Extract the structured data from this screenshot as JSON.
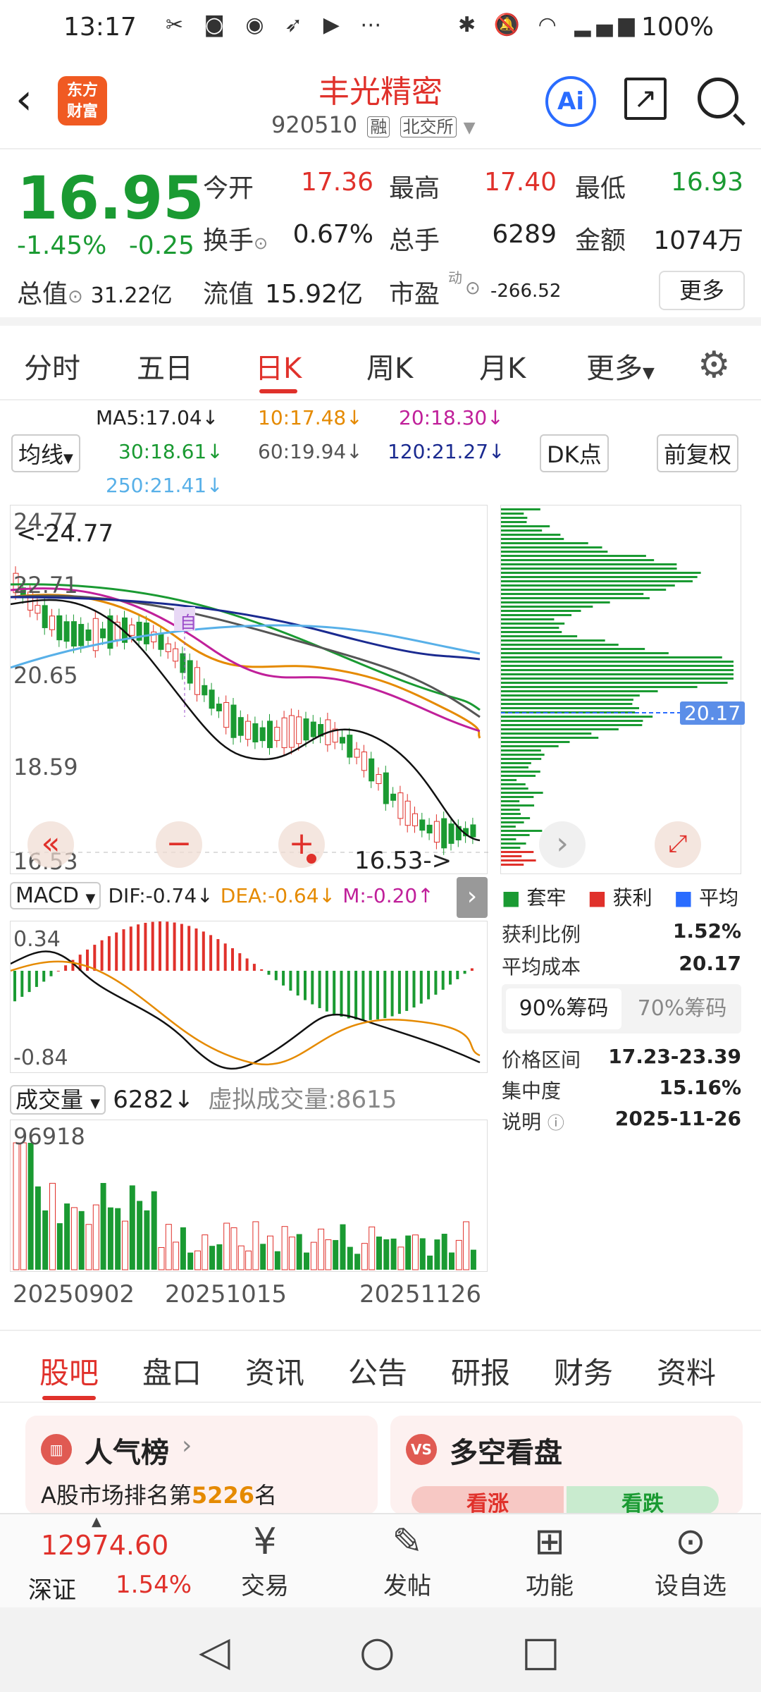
{
  "status": {
    "time": "13:17",
    "battery": "100%"
  },
  "header": {
    "title": "丰光精密",
    "code": "920510",
    "tag1": "融",
    "tag2": "北交所",
    "logo_line1": "东方",
    "logo_line2": "财富",
    "ai": "Ai"
  },
  "quote": {
    "price": "16.95",
    "change_pct": "-1.45%",
    "change_abs": "-0.25",
    "open_label": "今开",
    "open": "17.36",
    "high_label": "最高",
    "high": "17.40",
    "low_label": "最低",
    "low": "16.93",
    "turnover_label": "换手",
    "turnover": "0.67%",
    "volume_label": "总手",
    "volume": "6289",
    "amount_label": "金额",
    "amount": "1074万",
    "mktcap_label": "总值",
    "mktcap": "31.22亿",
    "float_label": "流值",
    "float": "15.92亿",
    "pe_label": "市盈",
    "pe_sup": "动",
    "pe": "-266.52",
    "more": "更多"
  },
  "tabs": [
    "分时",
    "五日",
    "日K",
    "周K",
    "月K",
    "更多"
  ],
  "ma": {
    "selector": "均线",
    "ma5": "MA5:17.04↓",
    "ma10": "10:17.48↓",
    "ma20": "20:18.30↓",
    "ma30": "30:18.61↓",
    "ma60": "60:19.94↓",
    "ma120": "120:21.27↓",
    "ma250": "250:21.41↓",
    "dk": "DK点",
    "fq": "前复权"
  },
  "kchart": {
    "y_labels": [
      "24.77",
      "22.71",
      "20.65",
      "18.59",
      "16.53"
    ],
    "max_marker": "<-24.77",
    "min_marker": "16.53->",
    "self_tag": "自"
  },
  "chip": {
    "avg_cost_marker": "20.17",
    "legend": [
      "套牢",
      "获利",
      "平均"
    ],
    "profit_ratio_label": "获利比例",
    "profit_ratio": "1.52%",
    "avg_cost_label": "平均成本",
    "avg_cost": "20.17",
    "tab90": "90%筹码",
    "tab70": "70%筹码",
    "range_label": "价格区间",
    "range": "17.23-23.39",
    "conc_label": "集中度",
    "conc": "15.16%",
    "note_label": "说明",
    "note": "2025-11-26"
  },
  "macd": {
    "name": "MACD",
    "dif": "DIF:-0.74↓",
    "dea": "DEA:-0.64↓",
    "m": "M:-0.20↑",
    "top": "0.34",
    "bottom": "-0.84"
  },
  "vol": {
    "name": "成交量",
    "value": "6282↓",
    "virtual": "虚拟成交量:8615",
    "max": "96918",
    "dates": [
      "20250902",
      "20251015",
      "20251126"
    ]
  },
  "ftabs": [
    "股吧",
    "盘口",
    "资讯",
    "公告",
    "研报",
    "财务",
    "资料"
  ],
  "cards": {
    "hot_title": "人气榜",
    "hot_sub_prefix": "A股市场排名第",
    "hot_rank": "5226",
    "hot_sub_suffix": "名",
    "vs_title": "多空看盘",
    "vs_icon": "VS",
    "up": "看涨",
    "down": "看跌"
  },
  "bnav": {
    "index_value": "12974.60",
    "index_name": "深证",
    "index_pct": "1.54%",
    "items": [
      "交易",
      "发帖",
      "功能",
      "设自选"
    ]
  },
  "colors": {
    "red": "#e0312b",
    "green": "#1a9a32",
    "blue": "#2a6cff"
  }
}
